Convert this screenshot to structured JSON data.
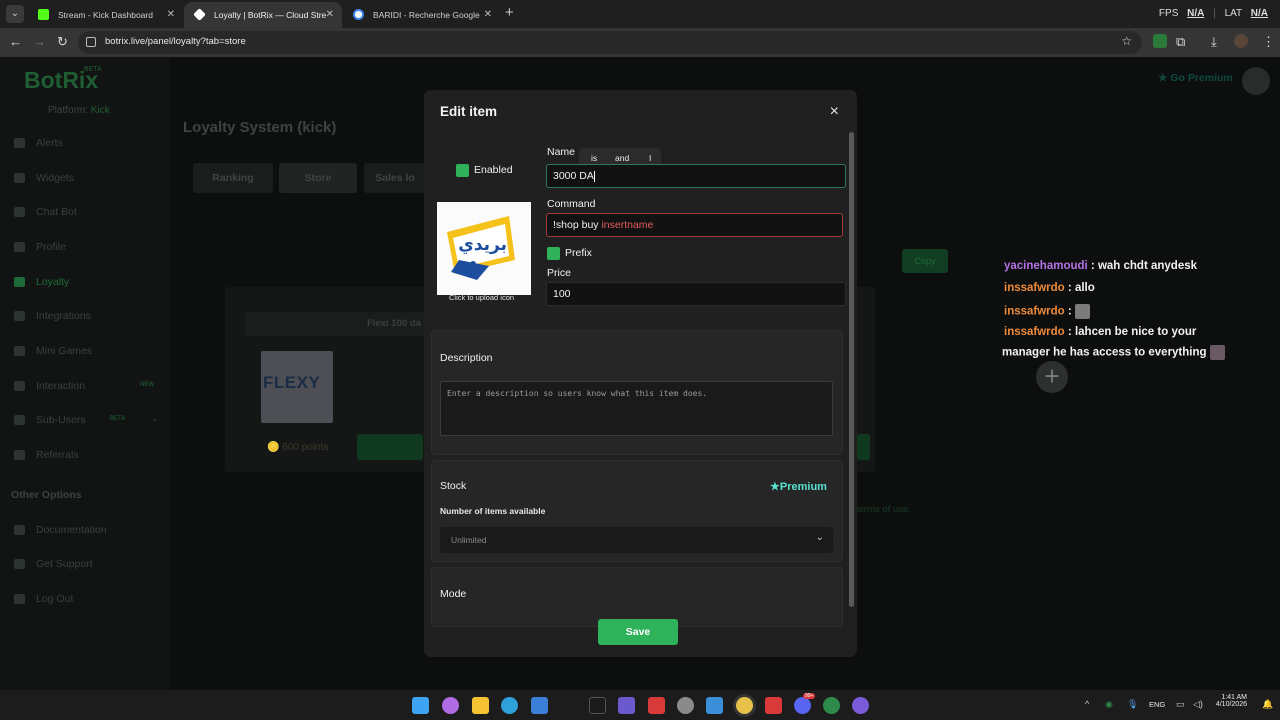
{
  "browser": {
    "tabs": [
      {
        "title": "Stream - Kick Dashboard",
        "active": false,
        "favicon_color": "#53fc18"
      },
      {
        "title": "Loyalty | BotRix — Cloud Stream",
        "active": true,
        "favicon_color": "#ffffff"
      },
      {
        "title": "BARIDI - Recherche Google",
        "active": false,
        "favicon_color": "#4285f4"
      }
    ],
    "new_tab": "+",
    "url": "botrix.live/panel/loyalty?tab=store",
    "fps_label": "FPS",
    "fps_value": "N/A",
    "lat_label": "LAT",
    "lat_value": "N/A"
  },
  "page": {
    "logo": "BotRix",
    "logo_badge": "BETA",
    "platform_label": "Platform:",
    "platform_value": "Kick",
    "sidebar": [
      {
        "label": "Alerts"
      },
      {
        "label": "Widgets"
      },
      {
        "label": "Chat Bot"
      },
      {
        "label": "Profile"
      },
      {
        "label": "Loyalty",
        "active": true
      },
      {
        "label": "Integrations"
      },
      {
        "label": "Mini Games"
      },
      {
        "label": "Interaction",
        "badge": "NEW"
      },
      {
        "label": "Sub-Users",
        "badge": "BETA"
      },
      {
        "label": "Referrals"
      }
    ],
    "other_options_title": "Other Options",
    "other_options": [
      {
        "label": "Documentation"
      },
      {
        "label": "Get Support"
      },
      {
        "label": "Log Out"
      }
    ],
    "title": "Loyalty System (kick)",
    "tabs": [
      "Ranking",
      "Store",
      "Sales lo"
    ],
    "copy_label": "Copy",
    "card_title": "Flexi 100 da",
    "card_points": "🪙 600 points",
    "terms": "terms of use.",
    "go_premium": "Go Premium"
  },
  "chat": [
    {
      "user": "yacinehamoudi",
      "user_color": "purple",
      "text": "wah chdt anydesk"
    },
    {
      "user": "inssafwrdo",
      "text": "allo"
    },
    {
      "user": "inssafwrdo",
      "text": "",
      "emote": true
    },
    {
      "user": "inssafwrdo",
      "text": "lahcen be nice to your"
    },
    {
      "user": "",
      "text": "manager he has access to everything"
    }
  ],
  "modal": {
    "title": "Edit item",
    "close": "×",
    "enabled_label": "Enabled",
    "name_label": "Name",
    "name_value": "3000 DA",
    "suggestions": [
      "is",
      "and",
      "I"
    ],
    "command_label": "Command",
    "command_prefix": "!shop buy ",
    "command_var": "insertname",
    "prefix_label": "Prefix",
    "price_label": "Price",
    "price_value": "100",
    "upload_hint": "Click to upload icon",
    "upload_image_text": "بريدي",
    "description_title": "Description",
    "description_placeholder": "Enter a description so users know what this item does.",
    "stock_title": "Stock",
    "premium_label": "Premium",
    "stock_sub_label": "Number of items available",
    "stock_value": "Unlimited",
    "mode_title": "Mode",
    "save_label": "Save"
  },
  "taskbar": {
    "lang": "ENG",
    "time": "1:41 AM",
    "date": "4/10/2026",
    "badge": "99+"
  }
}
